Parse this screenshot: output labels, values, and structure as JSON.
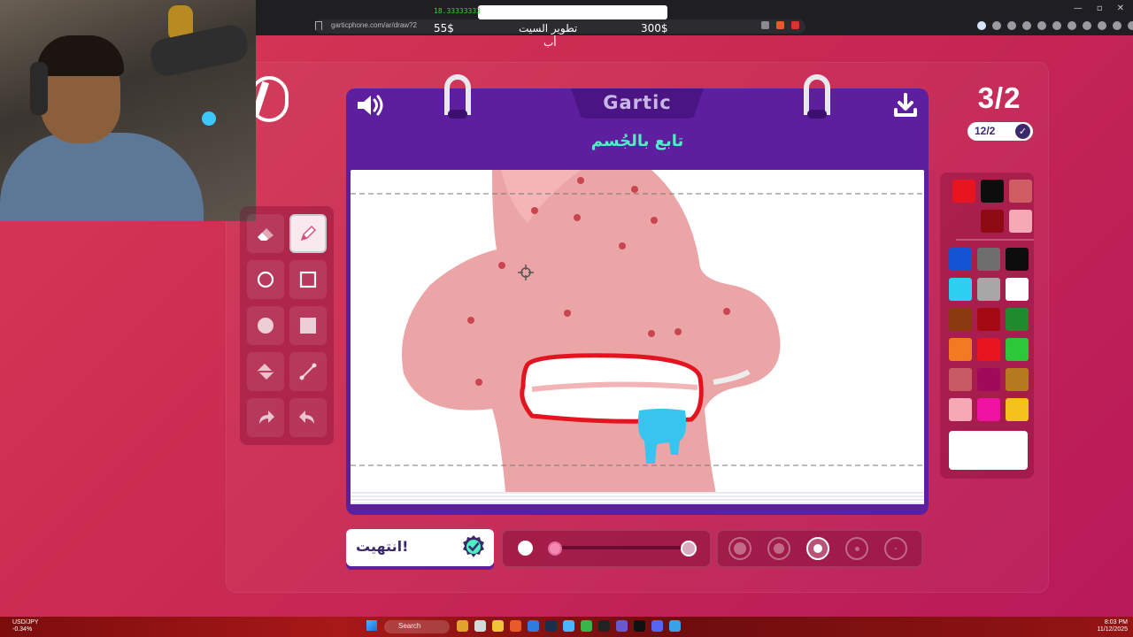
{
  "browser": {
    "url": "garticphone.com/ar/draw?2",
    "window_controls": [
      "—",
      "▫",
      "✕"
    ]
  },
  "stream_overlay": {
    "ticker": "18.33333333",
    "left_amount": "55$",
    "goal_line1": "تطوير السيت",
    "goal_line2": "أب",
    "right_amount": "300$"
  },
  "game": {
    "logo": "Gartic",
    "prompt": "تابع بالجُسم",
    "round_counter": "3/2",
    "ready_count": "12/2",
    "done_button_label": "انتهيت!"
  },
  "tools": [
    {
      "name": "eraser-tool",
      "icon": "eraser-icon"
    },
    {
      "name": "pencil-tool",
      "icon": "pencil-icon",
      "active": true
    },
    {
      "name": "circle-outline-tool",
      "icon": "circle-outline-icon"
    },
    {
      "name": "rectangle-outline-tool",
      "icon": "rectangle-outline-icon"
    },
    {
      "name": "circle-filled-tool",
      "icon": "circle-filled-icon"
    },
    {
      "name": "rectangle-filled-tool",
      "icon": "rectangle-filled-icon"
    },
    {
      "name": "fill-bucket-tool",
      "icon": "fill-bucket-icon"
    },
    {
      "name": "line-tool",
      "icon": "line-icon"
    },
    {
      "name": "redo-tool",
      "icon": "redo-icon"
    },
    {
      "name": "undo-tool",
      "icon": "undo-icon"
    }
  ],
  "palette": {
    "recent": [
      "#e8141f",
      "#0d0d0d",
      "#d05c64",
      "#8e0b14",
      "#f6a8b5"
    ],
    "colors": [
      "#1453d4",
      "#6e6e6e",
      "#0d0d0d",
      "#2dd0f0",
      "#a7a7a7",
      "#ffffff",
      "#8b3a10",
      "#a30a14",
      "#1e8b2c",
      "#f47a22",
      "#e8141f",
      "#2cc83a",
      "#c75a63",
      "#a10a5a",
      "#b87a1e",
      "#f6a8b5",
      "#f012a0",
      "#f5c21c"
    ],
    "current_color": "#ffffff"
  },
  "brush": {
    "opacity_fraction": 0.04,
    "sizes": 5,
    "selected_size_index": 2
  },
  "taskbar": {
    "ticker_line1": "USD/JPY",
    "ticker_line2": "-0.34%",
    "search_label": "Search",
    "clock_time": "8:03 PM",
    "clock_date": "11/12/2025"
  }
}
